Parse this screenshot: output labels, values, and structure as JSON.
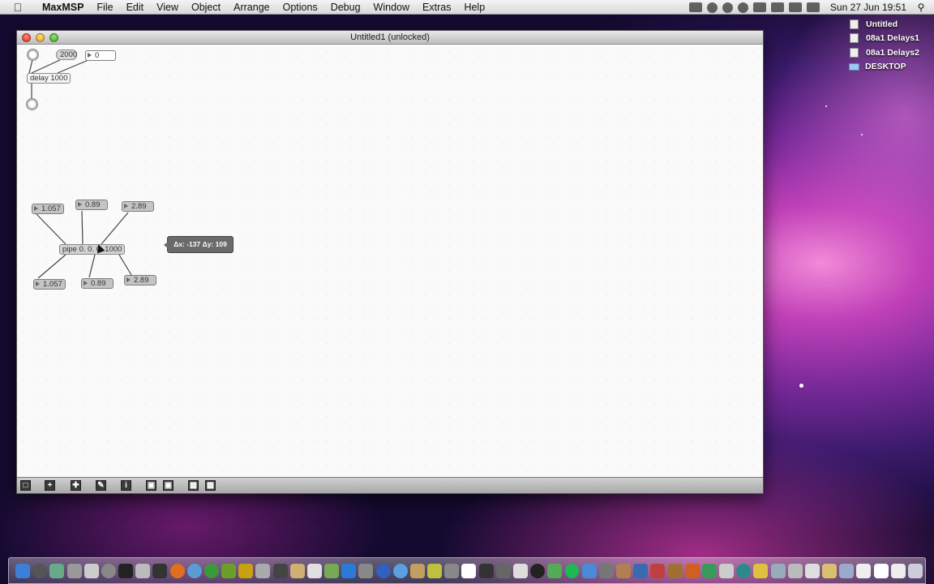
{
  "menubar": {
    "app_name": "MaxMSP",
    "items": [
      "File",
      "Edit",
      "View",
      "Object",
      "Arrange",
      "Options",
      "Debug",
      "Window",
      "Extras",
      "Help"
    ],
    "clock": "Sun 27 Jun  19:51"
  },
  "desktop": {
    "items": [
      {
        "label": "Untitled",
        "icon": "document-icon"
      },
      {
        "label": "08a1 Delays1",
        "icon": "document-icon"
      },
      {
        "label": "08a1 Delays2",
        "icon": "document-icon"
      },
      {
        "label": "DESKTOP",
        "icon": "folder-icon"
      }
    ]
  },
  "window": {
    "title": "Untitled1 (unlocked)"
  },
  "patch": {
    "msg_2000": "2000",
    "num_zero": "0",
    "delay_obj": "delay 1000",
    "pipe_obj": "pipe 0. 0. 0. 1000",
    "in_num1": "1.057",
    "in_num2": "0.89",
    "in_num3": "2.89",
    "out_num1": "1.057",
    "out_num2": "0.89",
    "out_num3": "2.89"
  },
  "tooltip": "Δx: -137 Δy: 109",
  "toolbar": {
    "buttons": [
      "lock-icon",
      "add-icon",
      "move-icon",
      "edit-icon",
      "info-icon",
      "bring-front-icon",
      "send-back-icon",
      "grid-icon",
      "snap-icon"
    ]
  }
}
